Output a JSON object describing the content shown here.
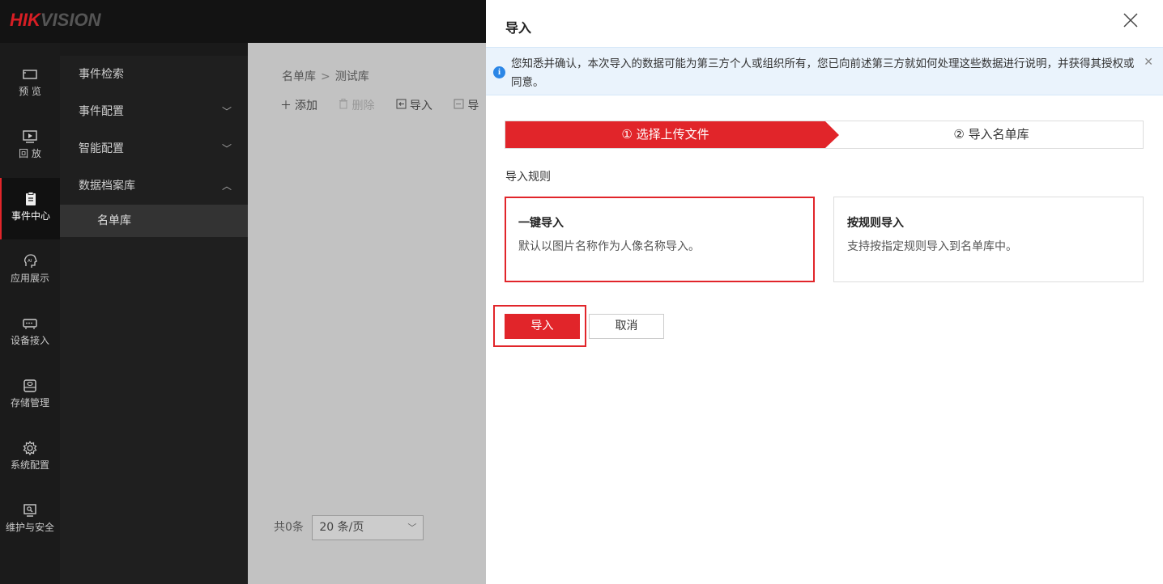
{
  "brand": {
    "logo_hik": "HIK",
    "logo_vision": "VISION"
  },
  "leftnav": {
    "items": [
      {
        "label": "预 览",
        "icon": "monitor-icon"
      },
      {
        "label": "回 放",
        "icon": "playback-icon"
      },
      {
        "label": "事件中心",
        "icon": "clipboard-icon",
        "active": true
      },
      {
        "label": "应用展示",
        "icon": "ai-head-icon"
      },
      {
        "label": "设备接入",
        "icon": "device-icon"
      },
      {
        "label": "存储管理",
        "icon": "storage-icon"
      },
      {
        "label": "系统配置",
        "icon": "gear-icon"
      },
      {
        "label": "维护与安全",
        "icon": "maintenance-icon"
      }
    ]
  },
  "subnav": {
    "items": [
      {
        "label": "事件检索"
      },
      {
        "label": "事件配置",
        "chevron": "﹀"
      },
      {
        "label": "智能配置",
        "chevron": "﹀"
      },
      {
        "label": "数据档案库",
        "chevron": "︿"
      }
    ],
    "child": {
      "label": "名单库"
    }
  },
  "main": {
    "breadcrumb": {
      "root": "名单库",
      "sep": ">",
      "current": "测试库"
    },
    "toolbar": {
      "add": "添加",
      "delete": "删除",
      "import": "导入",
      "export": "导"
    },
    "pager": {
      "total": "共0条",
      "page_size": "20 条/页"
    }
  },
  "dialog": {
    "title": "导入",
    "notice": "您知悉并确认，本次导入的数据可能为第三方个人或组织所有，您已向前述第三方就如何处理这些数据进行说明，并获得其授权或同意。",
    "steps": [
      {
        "label": "① 选择上传文件"
      },
      {
        "label": "② 导入名单库"
      }
    ],
    "rules_label": "导入规则",
    "cards": [
      {
        "title": "一键导入",
        "desc": "默认以图片名称作为人像名称导入。"
      },
      {
        "title": "按规则导入",
        "desc": "支持按指定规则导入到名单库中。"
      }
    ],
    "import_button": "导入",
    "cancel_button": "取消"
  },
  "colors": {
    "accent": "#e1252a",
    "notice_bg": "#eaf3fc",
    "info": "#2b86e6"
  }
}
